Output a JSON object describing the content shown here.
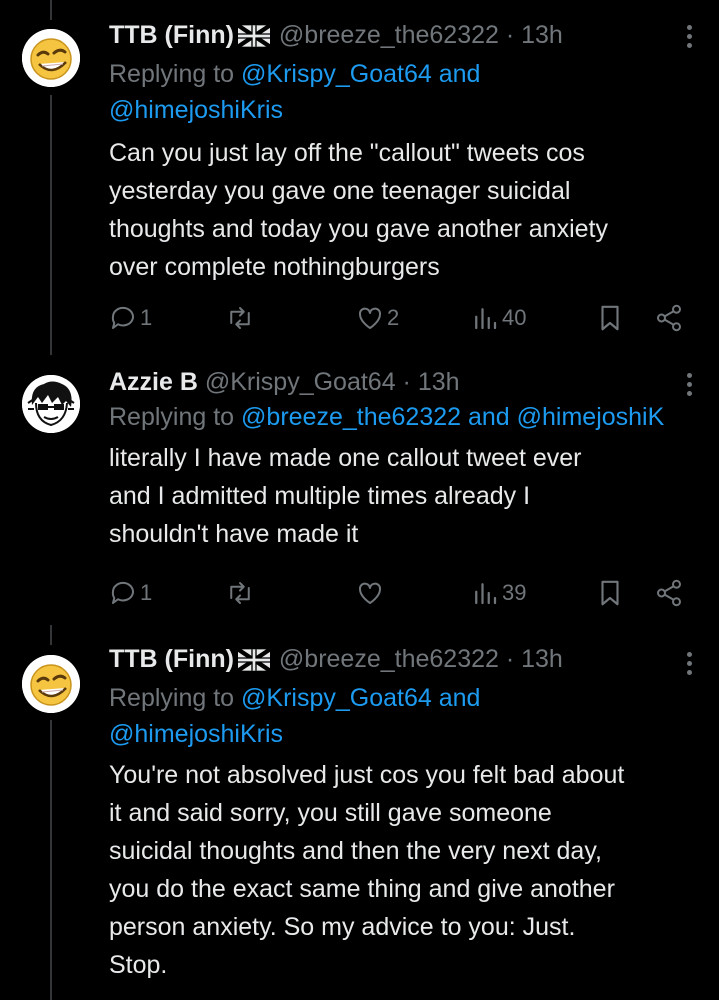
{
  "tweets": [
    {
      "display_name": "TTB (Finn)",
      "flag_icon": "uk-flag-icon",
      "handle_time": "@breeze_the62322 · 13h",
      "reply_prefix": "Replying to",
      "reply_to_line1": "@Krispy_Goat64 and",
      "reply_to_line2": "@himejoshiKris",
      "body_lines": [
        "Can you just lay off the \"callout\" tweets cos",
        "yesterday you gave one teenager suicidal",
        "thoughts and today you gave another anxiety",
        "over complete nothingburgers"
      ],
      "replies": "1",
      "retweets": "",
      "likes": "2",
      "views": "40"
    },
    {
      "display_name": "Azzie B",
      "handle_time": "@Krispy_Goat64 · 13h",
      "reply_prefix": "Replying to",
      "reply_to_line1": "@breeze_the62322 and @himejoshiK",
      "body_lines": [
        "literally I have made one callout tweet ever",
        "and I admitted multiple times already I",
        "shouldn't have made it"
      ],
      "replies": "1",
      "retweets": "",
      "likes": "",
      "views": "39"
    },
    {
      "display_name": "TTB (Finn)",
      "flag_icon": "uk-flag-icon",
      "handle_time": "@breeze_the62322 · 13h",
      "reply_prefix": "Replying to",
      "reply_to_line1": "@Krispy_Goat64 and",
      "reply_to_line2": "@himejoshiKris",
      "body_lines": [
        "You're not absolved just cos you felt bad about",
        "it and said sorry, you still gave someone",
        "suicidal thoughts and then the very next day,",
        "you do the exact same thing and give another",
        "person anxiety. So my advice to you: Just.",
        "Stop."
      ]
    }
  ],
  "colors": {
    "background": "#000000",
    "text": "#e7e9ea",
    "muted": "#71767b",
    "link": "#1d9bf0",
    "thread_line": "#333639"
  }
}
